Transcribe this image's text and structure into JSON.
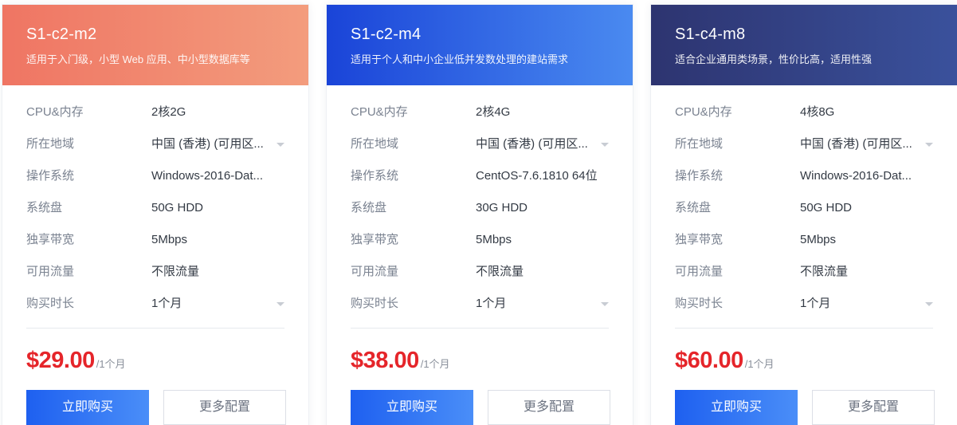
{
  "labels": {
    "cpu_mem": "CPU&内存",
    "region": "所在地域",
    "os": "操作系统",
    "disk": "系统盘",
    "bandwidth": "独享带宽",
    "traffic": "可用流量",
    "duration": "购买时长",
    "buy": "立即购买",
    "more": "更多配置"
  },
  "plans": [
    {
      "name": "S1-c2-m2",
      "desc": "适用于入门级，小型 Web 应用、中小型数据库等",
      "cpu_mem": "2核2G",
      "region": "中国 (香港) (可用区...",
      "os": "Windows-2016-Dat...",
      "disk": "50G HDD",
      "bandwidth": "5Mbps",
      "traffic": "不限流量",
      "duration": "1个月",
      "price": "$29.00",
      "price_unit": "/1个月"
    },
    {
      "name": "S1-c2-m4",
      "desc": "适用于个人和中小企业低并发数处理的建站需求",
      "cpu_mem": "2核4G",
      "region": "中国 (香港) (可用区...",
      "os": "CentOS-7.6.1810 64位",
      "disk": "30G HDD",
      "bandwidth": "5Mbps",
      "traffic": "不限流量",
      "duration": "1个月",
      "price": "$38.00",
      "price_unit": "/1个月"
    },
    {
      "name": "S1-c4-m8",
      "desc": "适合企业通用类场景，性价比高，适用性强",
      "cpu_mem": "4核8G",
      "region": "中国 (香港) (可用区...",
      "os": "Windows-2016-Dat...",
      "disk": "50G HDD",
      "bandwidth": "5Mbps",
      "traffic": "不限流量",
      "duration": "1个月",
      "price": "$60.00",
      "price_unit": "/1个月"
    }
  ],
  "colors": {
    "price": "#e5252a",
    "buy_button": "#2f6ff3",
    "card1_header": "#f08a70",
    "card2_header": "#2f66e6",
    "card3_header": "#354587"
  }
}
